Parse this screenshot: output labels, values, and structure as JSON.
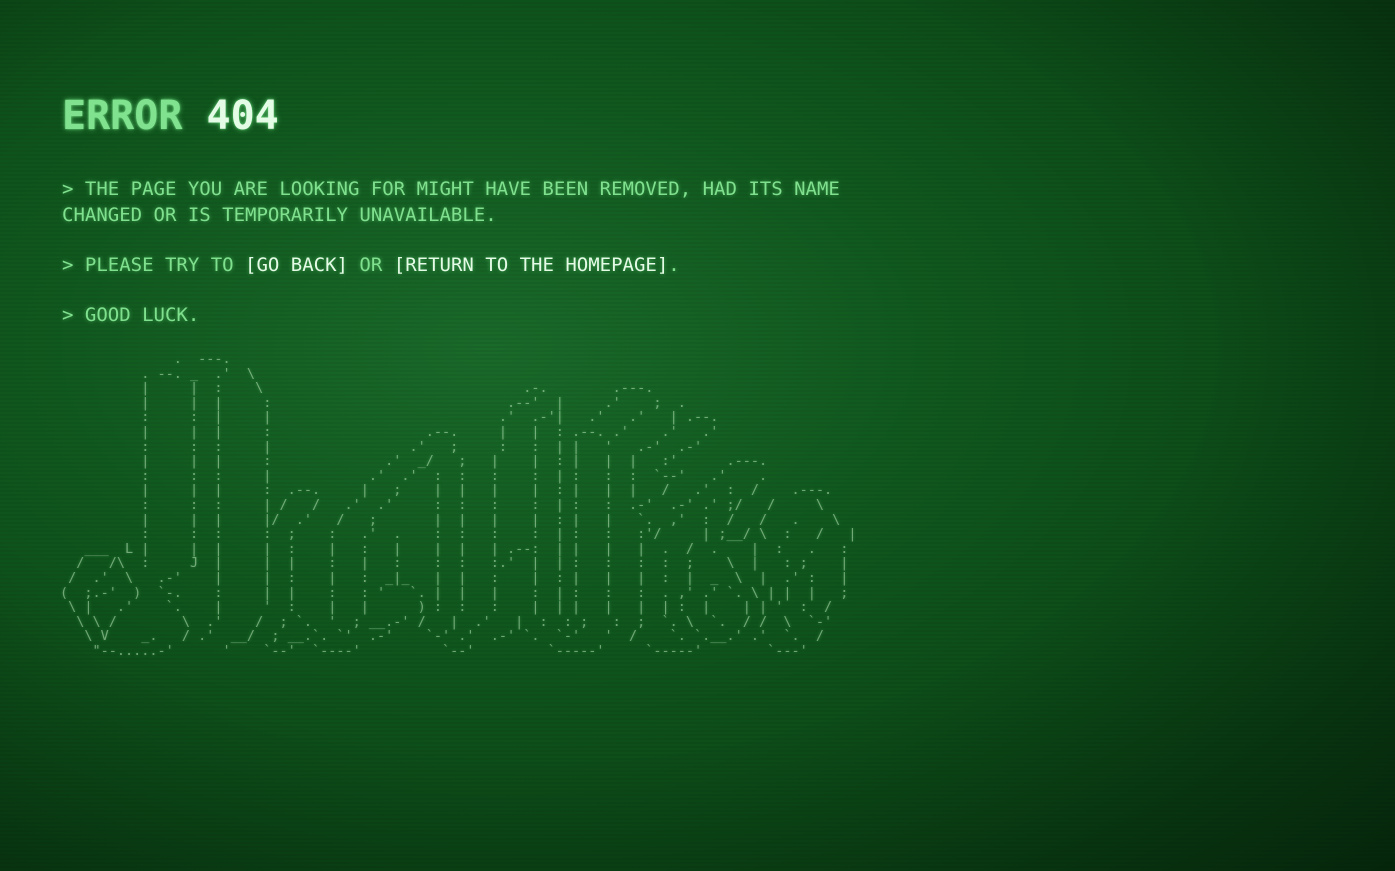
{
  "error": {
    "word": "ERROR",
    "code": "404"
  },
  "messages": {
    "line1": "> THE PAGE YOU ARE LOOKING FOR MIGHT HAVE BEEN REMOVED, HAD ITS NAME\nCHANGED OR IS TEMPORARILY UNAVAILABLE.",
    "line2_prefix": "> PLEASE TRY TO ",
    "go_back": "[GO BACK]",
    "or": " OR ",
    "homepage": "[RETURN TO THE HOMEPAGE]",
    "line2_suffix": ".",
    "line3": "> GOOD LUCK."
  },
  "logo": {
    "ascii": "              .  ---.  \n          . --. _  .'  \\\n          |     |  :    \\                                .-.        .---.\n          |     |  |     :                             .--'  |     .'    ;  .\n          :     :  |     |                            .'  .-'|   .'   .'   | .--.\n          |     |  |     :                   .--.     |   |  : .--. .'    .'   .'\n          :     :  :     |                 .'   ;     :   :  | |   '   .-'  .-'\n          |     |  |     :              .'  _/   ;   |    |  : |   |  |   :'      .---.\n          :     :  :     |            .'  .'  :  :   :    :  | :   :  :  `--'   .'    .\n          |     |  |     :  .--.     |   ;    |  |   |    |  : |   |  |   /   .'  :  /    .---.\n          :     :  :     | /   /   .'  .'     :  :   :    :  | :   :  .-'  .-' .' ;/   /     \\\n          |     |  |     |/  .'   /   ;       |  |   |    |  : |   |   `.  ,'  :  /   /   .    \\\n          :     :  :     :  ;    :   .'  .    :  :   :    :  | :   :   :'/     | ;__/ \\  :   /   |\n   ___  L |     |  |     |  :    |   :   |    |  |   | .--:  | |   |   |  .  /  .    |  :   .   :\n  /   /\\  :     J  |     |  |    :   |   :    :  :   :.'  |  | :   :   :  :  ;    \\  |   : ;    |\n /  .'  \\   .-'    |     |  :    |   :  _|_   |  |   :    |  : |   |   |  :  |  _  \\  |  .' :   |\n(  ;.-'  )  `-.    :     |  |    :   : '   `. |  |   |    :  | :   :   :  . ,' .' `. \\ | |  |   ;\n \\ |   .'    `.    |     '  :    |   |      ) :  :   :    |  | |   |   |  | :  |    | | '  :  /\n  \\ \\ /        \\  .'    /  ; `.  '  ; __.-' /   |  .'   |  :  : ;   :  ;  `. \\  `.  / /  \\  `-'\n   \\ V    _.   / .'  __/  ; __.`. `'  .-'    `-' .'  .-' `.  `-'   '  /    `. `.__.' .'  `.  /\n    \"--.....-'      '    `--'  `----'          `--'         `-----'     `-----'        `---'"
  }
}
